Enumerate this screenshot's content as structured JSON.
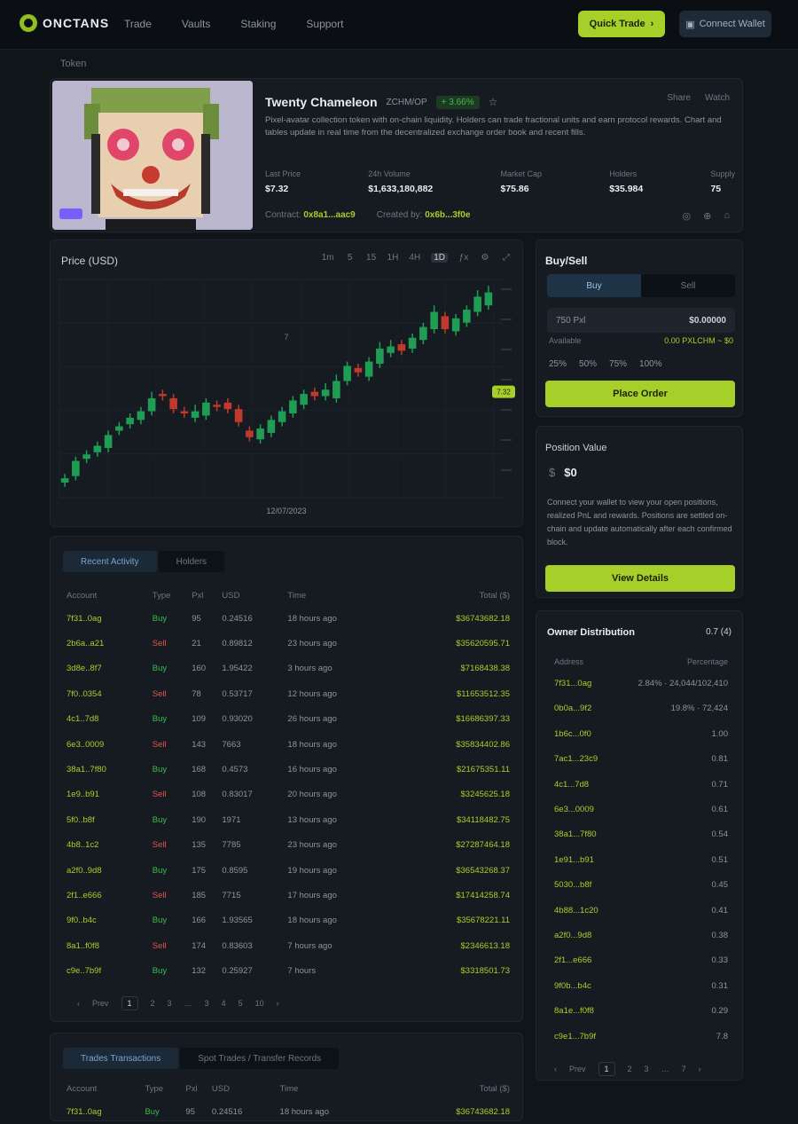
{
  "app": {
    "brand": "ONCTANS"
  },
  "nav": [
    "Trade",
    "Vaults",
    "Staking",
    "Support"
  ],
  "header_buttons": {
    "primary": "Quick Trade",
    "secondary": "Connect Wallet"
  },
  "breadcrumb": "Token",
  "token": {
    "name": "Twenty Chameleon",
    "symbol": "ZCHM/OP",
    "change": "+ 3.66%",
    "star": "☆",
    "links": [
      "Share",
      "Watch"
    ],
    "description": "Pixel-avatar collection token with on-chain liquidity. Holders can trade fractional units and earn protocol rewards. Chart and tables update in real time from the decentralized exchange order book and recent fills.",
    "stats": [
      {
        "label": "Last Price",
        "value": "$7.32"
      },
      {
        "label": "24h Volume",
        "value": "$1,633,180,882"
      },
      {
        "label": "Market Cap",
        "value": "$75.86"
      },
      {
        "label": "Holders",
        "value": "$35.984"
      },
      {
        "label": "Supply",
        "value": "75"
      }
    ],
    "footer": [
      {
        "label": "Contract:",
        "value": "0x8a1...aac9"
      },
      {
        "label": "Created by:",
        "value": "0x6b...3f0e"
      }
    ],
    "footer_icons": [
      "◎",
      "⊕",
      "⌂"
    ]
  },
  "chart": {
    "title": "Price (USD)",
    "tools": [
      "1m",
      "5",
      "15",
      "1H",
      "4H",
      "1D",
      "ƒx",
      "⚙",
      "⤢"
    ],
    "active_tool": "1D",
    "x_label": "12/07/2023",
    "price_tag": "7.32",
    "mid_label": "7"
  },
  "chart_data": {
    "type": "candlestick",
    "x": [
      "1",
      "2",
      "3",
      "4",
      "5",
      "6",
      "7",
      "8",
      "9",
      "10",
      "11",
      "12",
      "13",
      "14",
      "15",
      "16",
      "17",
      "18",
      "19",
      "20",
      "21",
      "22",
      "23",
      "24",
      "25",
      "26",
      "27",
      "28",
      "29",
      "30",
      "31",
      "32",
      "33",
      "34",
      "35",
      "36",
      "37",
      "38",
      "39",
      "40"
    ],
    "open": [
      1.2,
      1.5,
      2.3,
      2.6,
      2.8,
      3.6,
      3.9,
      4.1,
      4.5,
      5.3,
      5.1,
      4.5,
      4.2,
      4.3,
      4.8,
      4.9,
      4.6,
      3.6,
      3.2,
      3.5,
      4.0,
      4.4,
      4.8,
      5.4,
      5.2,
      5.1,
      5.9,
      6.5,
      6.1,
      6.7,
      7.2,
      7.6,
      7.4,
      7.8,
      8.3,
      8.9,
      8.2,
      8.6,
      9.1,
      9.4
    ],
    "close": [
      1.4,
      2.2,
      2.5,
      2.9,
      3.4,
      3.8,
      4.2,
      4.5,
      5.1,
      5.2,
      4.6,
      4.4,
      4.5,
      4.9,
      4.7,
      4.6,
      4.0,
      3.3,
      3.7,
      4.1,
      4.5,
      5.0,
      5.3,
      5.2,
      5.5,
      5.9,
      6.6,
      6.3,
      6.8,
      7.4,
      7.5,
      7.3,
      7.9,
      8.4,
      9.1,
      8.3,
      8.8,
      9.2,
      9.8,
      10.0
    ],
    "high": [
      1.6,
      2.4,
      2.7,
      3.1,
      3.6,
      4.0,
      4.4,
      4.7,
      5.4,
      5.5,
      5.3,
      4.7,
      4.8,
      5.1,
      5.0,
      5.1,
      4.8,
      3.8,
      3.9,
      4.3,
      4.7,
      5.2,
      5.5,
      5.6,
      5.8,
      6.2,
      6.8,
      6.7,
      7.0,
      7.7,
      7.8,
      7.8,
      8.1,
      8.6,
      9.4,
      9.1,
      9.0,
      9.4,
      10.1,
      10.3
    ],
    "low": [
      1.0,
      1.3,
      2.1,
      2.4,
      2.6,
      3.4,
      3.7,
      3.9,
      4.3,
      5.0,
      4.4,
      4.2,
      4.0,
      4.1,
      4.5,
      4.4,
      3.8,
      3.1,
      3.0,
      3.3,
      3.8,
      4.2,
      4.6,
      5.0,
      5.0,
      4.9,
      5.7,
      6.1,
      5.9,
      6.5,
      7.0,
      7.1,
      7.2,
      7.6,
      8.1,
      8.1,
      8.0,
      8.4,
      8.9,
      9.2
    ],
    "colors": {
      "up": "#1f9d55",
      "down": "#c0392b"
    }
  },
  "trade": {
    "title": "Buy/Sell",
    "tabs": [
      "Buy",
      "Sell"
    ],
    "input_label": "750 Pxl",
    "input_value": "$0.00000",
    "avail_label": "Available",
    "avail_value": "0.00 PXLCHM  ~ $0",
    "percents": [
      "25%",
      "50%",
      "75%",
      "100%"
    ],
    "button": "Place Order"
  },
  "position": {
    "title": "Position Value",
    "currency": "$",
    "value": "$0",
    "description": "Connect your wallet to view your open positions, realized PnL and rewards. Positions are settled on-chain and update automatically after each confirmed block.",
    "button": "View Details"
  },
  "owners": {
    "title": "Owner Distribution",
    "percent": "0.7 (4)",
    "headers": [
      "Address",
      "Percentage"
    ],
    "rows": [
      {
        "address": "7f31...0ag",
        "value": "2.84% · 24,044/102,410"
      },
      {
        "address": "0b0a...9f2",
        "value": "19.8% · 72,424"
      },
      {
        "address": "1b6c...0f0",
        "value": "1.00"
      },
      {
        "address": "7ac1...23c9",
        "value": "0.81"
      },
      {
        "address": "4c1...7d8",
        "value": "0.71"
      },
      {
        "address": "6e3...0009",
        "value": "0.61"
      },
      {
        "address": "38a1...7f80",
        "value": "0.54"
      },
      {
        "address": "1e91...b91",
        "value": "0.51"
      },
      {
        "address": "5030...b8f",
        "value": "0.45"
      },
      {
        "address": "4b88...1c20",
        "value": "0.41"
      },
      {
        "address": "a2f0...9d8",
        "value": "0.38"
      },
      {
        "address": "2f1...e666",
        "value": "0.33"
      },
      {
        "address": "9f0b...b4c",
        "value": "0.31"
      },
      {
        "address": "8a1e...f0f8",
        "value": "0.29"
      },
      {
        "address": "c9e1...7b9f",
        "value": "7.8"
      }
    ],
    "pager": [
      "‹",
      "Prev",
      "1",
      "2",
      "3",
      "…",
      "7",
      "›"
    ]
  },
  "transactions": {
    "tabs": [
      "Recent Activity",
      "Holders"
    ],
    "headers": [
      "Account",
      "Type",
      "Pxl",
      "USD",
      "Time",
      "Total ($)"
    ],
    "rows": [
      {
        "account": "7f31..0ag",
        "type": "Buy",
        "pxl": "95",
        "usd": "0.24516",
        "time": "18 hours ago",
        "total": "$36743682.18"
      },
      {
        "account": "2b6a..a21",
        "type": "Sell",
        "pxl": "21",
        "usd": "0.89812",
        "time": "23 hours ago",
        "total": "$35620595.71"
      },
      {
        "account": "3d8e..8f7",
        "type": "Buy",
        "pxl": "160",
        "usd": "1.95422",
        "time": "3 hours ago",
        "total": "$7168438.38"
      },
      {
        "account": "7f0..0354",
        "type": "Sell",
        "pxl": "78",
        "usd": "0.53717",
        "time": "12 hours ago",
        "total": "$11653512.35"
      },
      {
        "account": "4c1..7d8",
        "type": "Buy",
        "pxl": "109",
        "usd": "0.93020",
        "time": "26 hours ago",
        "total": "$16686397.33"
      },
      {
        "account": "6e3..0009",
        "type": "Sell",
        "pxl": "143",
        "usd": "7663",
        "time": "18 hours ago",
        "total": "$35834402.86"
      },
      {
        "account": "38a1..7f80",
        "type": "Buy",
        "pxl": "168",
        "usd": "0.4573",
        "time": "16 hours ago",
        "total": "$21675351.11"
      },
      {
        "account": "1e9..b91",
        "type": "Sell",
        "pxl": "108",
        "usd": "0.83017",
        "time": "20 hours ago",
        "total": "$3245625.18"
      },
      {
        "account": "5f0..b8f",
        "type": "Buy",
        "pxl": "190",
        "usd": "1971",
        "time": "13 hours ago",
        "total": "$34118482.75"
      },
      {
        "account": "4b8..1c2",
        "type": "Sell",
        "pxl": "135",
        "usd": "7785",
        "time": "23 hours ago",
        "total": "$27287464.18"
      },
      {
        "account": "a2f0..9d8",
        "type": "Buy",
        "pxl": "175",
        "usd": "0.8595",
        "time": "19 hours ago",
        "total": "$36543268.37"
      },
      {
        "account": "2f1..e666",
        "type": "Sell",
        "pxl": "185",
        "usd": "7715",
        "time": "17 hours ago",
        "total": "$17414258.74"
      },
      {
        "account": "9f0..b4c",
        "type": "Buy",
        "pxl": "166",
        "usd": "1.93565",
        "time": "18 hours ago",
        "total": "$35678221.11"
      },
      {
        "account": "8a1..f0f8",
        "type": "Sell",
        "pxl": "174",
        "usd": "0.83603",
        "time": "7 hours ago",
        "total": "$2346613.18"
      },
      {
        "account": "c9e..7b9f",
        "type": "Buy",
        "pxl": "132",
        "usd": "0.25927",
        "time": "7 hours",
        "total": "$3318501.73"
      }
    ],
    "pager": [
      "‹",
      "Prev",
      "1",
      "2",
      "3",
      "…",
      "3",
      "4",
      "5",
      "10",
      "›"
    ]
  },
  "holders_table": {
    "tabs": [
      "Trades Transactions",
      "Spot Trades / Transfer Records"
    ],
    "headers": [
      "Account",
      "Type",
      "Pxl",
      "USD",
      "Time",
      "Total ($)"
    ],
    "first_row": {
      "account": "7f31..0ag",
      "type": "Buy",
      "pxl": "95",
      "usd": "0.24516",
      "time": "18 hours ago",
      "total": "$36743682.18"
    }
  }
}
